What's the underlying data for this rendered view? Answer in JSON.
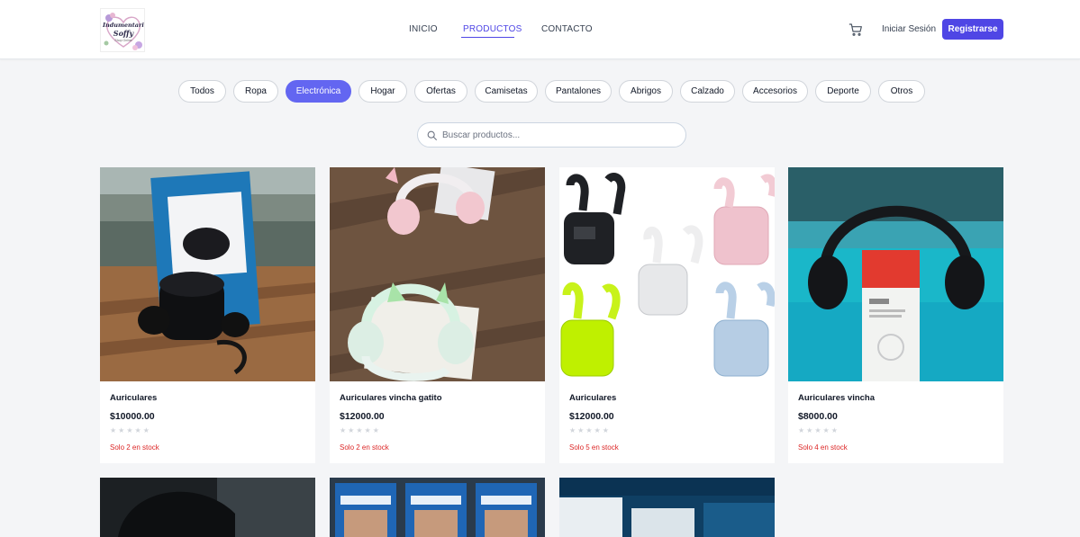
{
  "brand": {
    "logo_line1": "Indumentaria",
    "logo_line2": "Soffy",
    "logo_tagline": "Shop Online"
  },
  "nav": {
    "items": [
      {
        "label": "INICIO"
      },
      {
        "label": "PRODUCTOS",
        "active": true
      },
      {
        "label": "CONTACTO"
      }
    ]
  },
  "header": {
    "login_label": "Iniciar Sesión",
    "register_label": "Registrarse",
    "cart_icon": "cart-icon"
  },
  "filters": {
    "categories": [
      {
        "label": "Todos"
      },
      {
        "label": "Ropa"
      },
      {
        "label": "Electrónica",
        "active": true
      },
      {
        "label": "Hogar"
      },
      {
        "label": "Ofertas"
      },
      {
        "label": "Camisetas"
      },
      {
        "label": "Pantalones"
      },
      {
        "label": "Abrigos"
      },
      {
        "label": "Calzado"
      },
      {
        "label": "Accesorios"
      },
      {
        "label": "Deporte"
      },
      {
        "label": "Otros"
      }
    ]
  },
  "search": {
    "placeholder": "Buscar productos...",
    "value": ""
  },
  "products": [
    {
      "title": "Auriculares",
      "price": "$10000.00",
      "stars": "★★★★★",
      "stock": "Solo 2 en stock"
    },
    {
      "title": "Auriculares vincha gatito",
      "price": "$12000.00",
      "stars": "★★★★★",
      "stock": "Solo 2 en stock"
    },
    {
      "title": "Auriculares",
      "price": "$12000.00",
      "stars": "★★★★★",
      "stock": "Solo 5 en stock"
    },
    {
      "title": "Auriculares vincha",
      "price": "$8000.00",
      "stars": "★★★★★",
      "stock": "Solo 4 en stock"
    }
  ],
  "colors": {
    "accent": "#4f46e5",
    "chip_active": "#6366f1",
    "stock_warning": "#dc2626"
  }
}
